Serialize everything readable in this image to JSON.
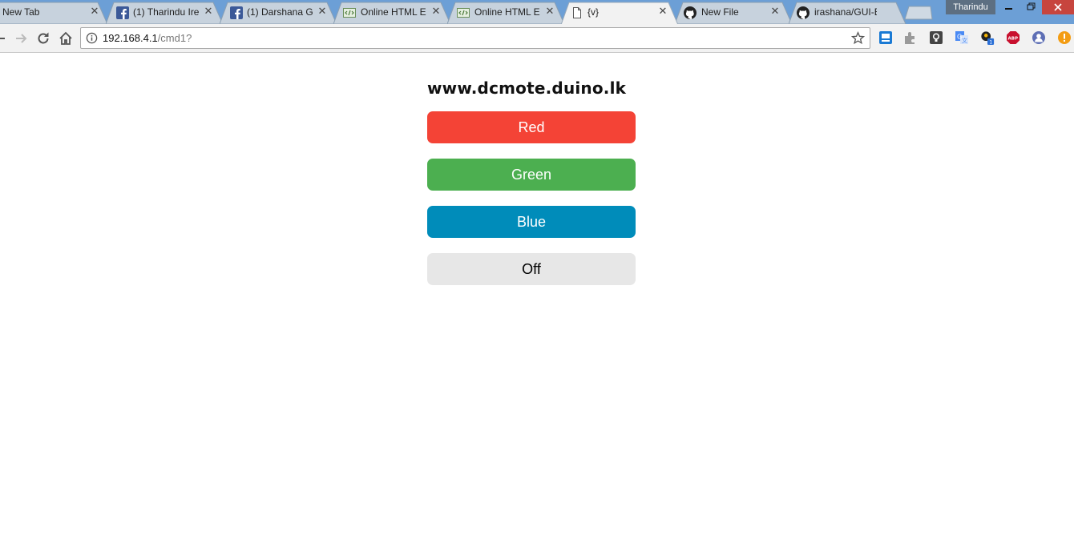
{
  "browser": {
    "tabs": [
      {
        "title": "New Tab",
        "favicon": "none",
        "active": false
      },
      {
        "title": "(1) Tharindu Ire",
        "favicon": "facebook-icon",
        "active": false
      },
      {
        "title": "(1) Darshana G",
        "favicon": "facebook-icon",
        "active": false
      },
      {
        "title": "Online HTML E",
        "favicon": "html-editor-icon",
        "active": false
      },
      {
        "title": "Online HTML E",
        "favicon": "html-editor-icon",
        "active": false
      },
      {
        "title": "{v}",
        "favicon": "document-icon",
        "active": true
      },
      {
        "title": "New File",
        "favicon": "github-icon",
        "active": false
      },
      {
        "title": "irashana/GUI-B",
        "favicon": "github-icon",
        "active": false
      }
    ],
    "close_glyph": "✕",
    "profile_name": "Tharindu",
    "address": {
      "host": "192.168.4.1",
      "path": "/cmd1?"
    },
    "colors": {
      "tabstrip": "#6c9fd6",
      "toolbar": "#f2f2f2"
    }
  },
  "page": {
    "title": "www.dcmote.duino.lk",
    "buttons": {
      "red": "Red",
      "green": "Green",
      "blue": "Blue",
      "off": "Off"
    },
    "colors": {
      "red": "#f44336",
      "green": "#4caf50",
      "blue": "#008cba",
      "off": "#e7e7e7"
    }
  }
}
